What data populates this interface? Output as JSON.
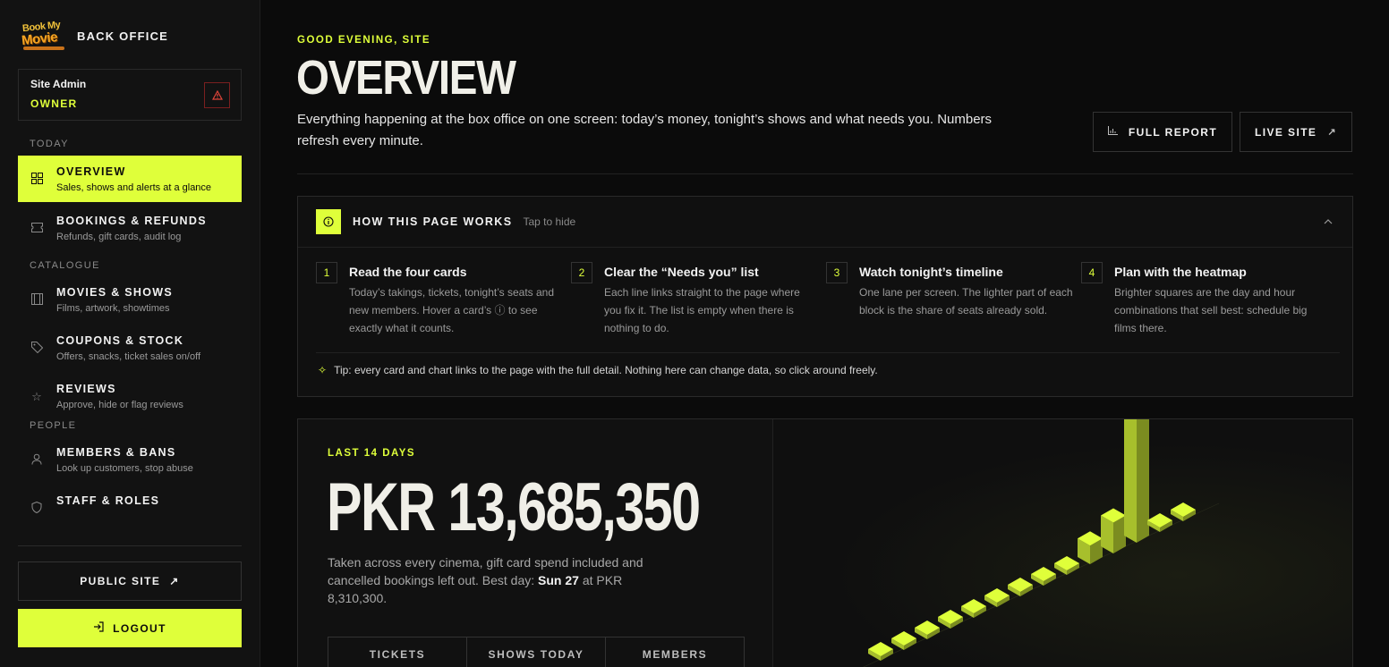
{
  "brand": {
    "logo_text": "Book My Movie",
    "name": "BACK OFFICE"
  },
  "admin": {
    "name": "Site Admin",
    "role": "OWNER",
    "alert_icon": "warning-icon"
  },
  "sidebar": {
    "sections": [
      {
        "label": "TODAY"
      },
      {
        "label": "CATALOGUE"
      },
      {
        "label": "PEOPLE"
      }
    ],
    "items": [
      {
        "title": "OVERVIEW",
        "sub": "Sales, shows and alerts at a glance",
        "icon": "grid-icon",
        "active": true
      },
      {
        "title": "BOOKINGS & REFUNDS",
        "sub": "Refunds, gift cards, audit log",
        "icon": "ticket-icon"
      },
      {
        "title": "MOVIES & SHOWS",
        "sub": "Films, artwork, showtimes",
        "icon": "film-icon"
      },
      {
        "title": "COUPONS & STOCK",
        "sub": "Offers, snacks, ticket sales on/off",
        "icon": "tag-icon"
      },
      {
        "title": "REVIEWS",
        "sub": "Approve, hide or flag reviews",
        "icon": "star-icon"
      },
      {
        "title": "MEMBERS & BANS",
        "sub": "Look up customers, stop abuse",
        "icon": "user-icon"
      },
      {
        "title": "STAFF & ROLES",
        "sub": "",
        "icon": "shield-icon"
      }
    ],
    "public_site": "PUBLIC SITE",
    "logout": "LOGOUT"
  },
  "header": {
    "greeting": "GOOD EVENING, SITE",
    "title": "OVERVIEW",
    "intro": "Everything happening at the box office on one screen: today’s money, tonight’s shows and what needs you. Numbers refresh every minute.",
    "full_report": "FULL REPORT",
    "live_site": "LIVE SITE"
  },
  "how": {
    "title": "HOW THIS PAGE WORKS",
    "hint": "Tap to hide",
    "steps": [
      {
        "num": "1",
        "title": "Read the four cards",
        "desc": "Today’s takings, tickets, tonight’s seats and new members. Hover a card’s ⓘ to see exactly what it counts."
      },
      {
        "num": "2",
        "title": "Clear the “Needs you” list",
        "desc": "Each line links straight to the page where you fix it. The list is empty when there is nothing to do."
      },
      {
        "num": "3",
        "title": "Watch tonight’s timeline",
        "desc": "One lane per screen. The lighter part of each block is the share of seats already sold."
      },
      {
        "num": "4",
        "title": "Plan with the heatmap",
        "desc": "Brighter squares are the day and hour combinations that sell best: schedule big films there."
      }
    ],
    "tip": "Tip: every card and chart links to the page with the full detail. Nothing here can change data, so click around freely."
  },
  "revenue": {
    "label": "LAST 14 DAYS",
    "amount": "PKR 13,685,350",
    "desc_before": "Taken across every cinema, gift card spend included and cancelled bookings left out. Best day: ",
    "best_day": "Sun 27",
    "desc_after": " at PKR 8,310,300.",
    "tabs": [
      "TICKETS",
      "SHOWS TODAY",
      "MEMBERS"
    ]
  },
  "chart_data": {
    "type": "bar",
    "title": "",
    "categories": [
      "",
      "",
      "",
      "",
      "",
      "",
      "",
      "",
      "",
      "",
      "",
      "",
      "",
      ""
    ],
    "values": [
      0.02,
      0.02,
      0.02,
      0.02,
      0.02,
      0.02,
      0.02,
      0.02,
      0.02,
      0.09,
      0.15,
      1.0,
      0.02,
      0.02
    ],
    "colors": {
      "bar": "#dfff3a"
    }
  }
}
